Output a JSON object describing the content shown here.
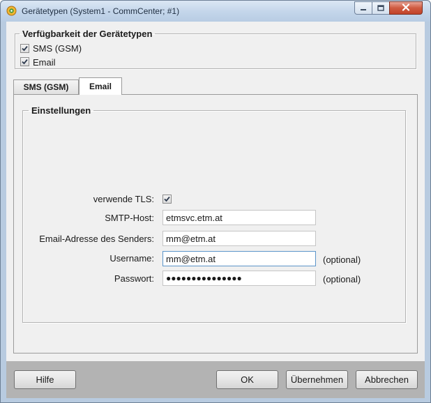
{
  "window": {
    "title": "Gerätetypen (System1 - CommCenter; #1)"
  },
  "availability": {
    "legend": "Verfügbarkeit der Gerätetypen",
    "items": [
      {
        "label": "SMS (GSM)",
        "checked": true
      },
      {
        "label": "Email",
        "checked": true
      }
    ]
  },
  "tabs": [
    {
      "label": "SMS (GSM)",
      "active": false
    },
    {
      "label": "Email",
      "active": true
    }
  ],
  "settings": {
    "legend": "Einstellungen",
    "tls": {
      "label": "verwende TLS:",
      "checked": true
    },
    "smtp_host": {
      "label": "SMTP-Host:",
      "value": "etmsvc.etm.at"
    },
    "sender": {
      "label": "Email-Adresse des Senders:",
      "value": "mm@etm.at"
    },
    "username": {
      "label": "Username:",
      "value": "mm@etm.at",
      "hint": "(optional)"
    },
    "password": {
      "label": "Passwort:",
      "value": "●●●●●●●●●●●●●●●",
      "hint": "(optional)"
    }
  },
  "buttons": {
    "help": "Hilfe",
    "ok": "OK",
    "apply": "Übernehmen",
    "cancel": "Abbrechen"
  },
  "colors": {
    "accent": "#5c95c9",
    "close_button": "#c2442a"
  }
}
